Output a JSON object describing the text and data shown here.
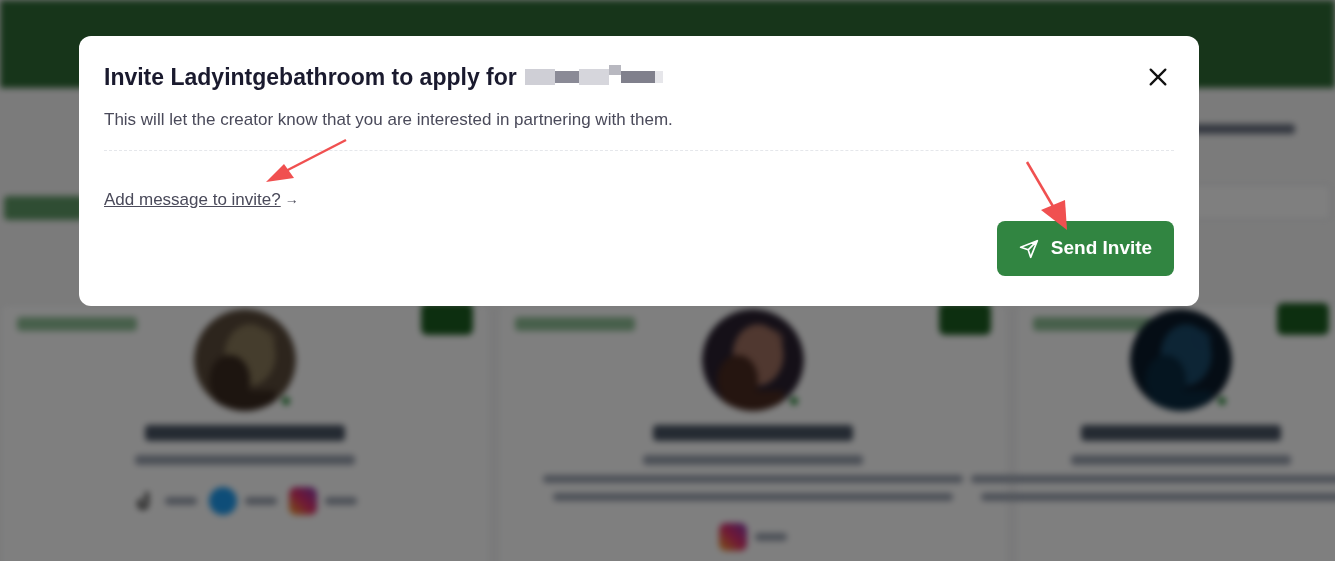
{
  "dialog": {
    "title": "Invite Ladyintgebathroom to apply for",
    "description": "This will let the creator know that you are interested in partnering with them.",
    "message_link": "Add message to invite?",
    "message_link_arrow": "→",
    "send_button": "Send Invite"
  }
}
